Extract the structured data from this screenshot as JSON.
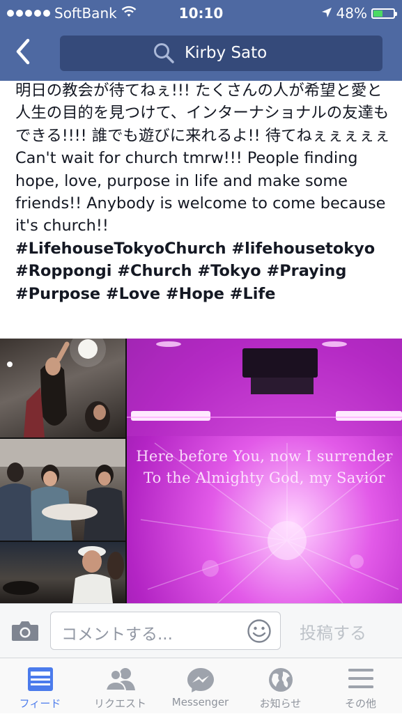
{
  "status_bar": {
    "carrier": "SoftBank",
    "time": "10:10",
    "battery_percent": "48%",
    "battery_level": 0.48,
    "signal_dots": 5,
    "icons": [
      "wifi-icon",
      "location-arrow-icon",
      "battery-icon"
    ]
  },
  "header": {
    "search_text": "Kirby Sato",
    "icons": [
      "back-chevron-icon",
      "search-icon"
    ],
    "colors": {
      "bar": "#4e69a2",
      "search_field": "#354a7a"
    }
  },
  "post": {
    "japanese_text": "明日の教会が待てねぇ!!! たくさんの人が希望と愛と人生の目的を見つけて、インターナショナルの友達もできる!!!! 誰でも遊びに来れるよ!! 待てねぇぇぇぇぇ",
    "english_text": "Can't wait for church tmrw!!! People finding hope, love, purpose in life and make some friends!! Anybody is welcome to come because it's church!!",
    "hashtags": "#LifehouseTokyoChurch #lifehousetokyo #Roppongi #Church #Tokyo #Praying #Purpose #Love #Hope #Life",
    "photo_text": {
      "lyric_line_1": "Here before You, now I surrender",
      "lyric_line_2": "To the Almighty God, my Savior"
    }
  },
  "comment_bar": {
    "placeholder": "コメントする...",
    "post_label": "投稿する",
    "icons": [
      "camera-icon",
      "emoji-smiley-icon"
    ]
  },
  "tab_bar": {
    "tabs": [
      {
        "label": "フィード",
        "icon": "news-feed-icon",
        "active": true
      },
      {
        "label": "リクエスト",
        "icon": "friend-requests-icon",
        "active": false
      },
      {
        "label": "Messenger",
        "icon": "messenger-icon",
        "active": false
      },
      {
        "label": "お知らせ",
        "icon": "globe-notifications-icon",
        "active": false
      },
      {
        "label": "その他",
        "icon": "menu-icon",
        "active": false
      }
    ],
    "colors": {
      "active": "#4b7bec",
      "inactive": "#8e939c"
    }
  }
}
